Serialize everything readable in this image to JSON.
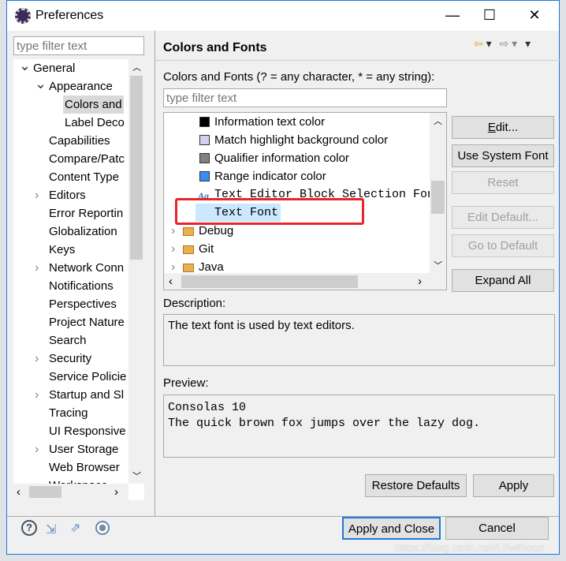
{
  "window": {
    "title": "Preferences",
    "minimize": "—",
    "maximize": "☐",
    "close": "✕"
  },
  "left": {
    "filter_placeholder": "type filter text",
    "tree": [
      {
        "label": "General",
        "level": 0,
        "expanded": true
      },
      {
        "label": "Appearance",
        "level": 1,
        "expanded": true
      },
      {
        "label": "Colors and",
        "level": 2,
        "selected": true
      },
      {
        "label": "Label Deco",
        "level": 2
      },
      {
        "label": "Capabilities",
        "level": 1
      },
      {
        "label": "Compare/Patc",
        "level": 1
      },
      {
        "label": "Content Type",
        "level": 1
      },
      {
        "label": "Editors",
        "level": 1,
        "expandable": true
      },
      {
        "label": "Error Reportin",
        "level": 1
      },
      {
        "label": "Globalization",
        "level": 1
      },
      {
        "label": "Keys",
        "level": 1
      },
      {
        "label": "Network Conn",
        "level": 1,
        "expandable": true
      },
      {
        "label": "Notifications",
        "level": 1
      },
      {
        "label": "Perspectives",
        "level": 1
      },
      {
        "label": "Project Nature",
        "level": 1
      },
      {
        "label": "Search",
        "level": 1
      },
      {
        "label": "Security",
        "level": 1,
        "expandable": true
      },
      {
        "label": "Service Policie",
        "level": 1
      },
      {
        "label": "Startup and Sl",
        "level": 1,
        "expandable": true
      },
      {
        "label": "Tracing",
        "level": 1
      },
      {
        "label": "UI Responsive",
        "level": 1
      },
      {
        "label": "User Storage",
        "level": 1,
        "expandable": true
      },
      {
        "label": "Web Browser",
        "level": 1
      },
      {
        "label": "Workspace",
        "level": 1,
        "expandable": true
      }
    ]
  },
  "main": {
    "title": "Colors and Fonts",
    "filter_label": "Colors and Fonts (? = any character, * = any string):",
    "filter_placeholder": "type filter text",
    "items": [
      {
        "label": "Information text color",
        "kind": "color",
        "color": "#000000"
      },
      {
        "label": "Match highlight background color",
        "kind": "color",
        "color": "#d4d0f0"
      },
      {
        "label": "Qualifier information color",
        "kind": "color",
        "color": "#808080"
      },
      {
        "label": "Range indicator color",
        "kind": "color",
        "color": "#3a8ef0"
      },
      {
        "label": "Text Editor Block Selection Font",
        "kind": "font"
      },
      {
        "label": "Text Font",
        "kind": "font",
        "selected": true
      },
      {
        "label": "Debug",
        "kind": "category"
      },
      {
        "label": "Git",
        "kind": "category"
      },
      {
        "label": "Java",
        "kind": "category"
      }
    ],
    "buttons": {
      "edit": "Edit...",
      "use_system_font": "Use System Font",
      "reset": "Reset",
      "edit_default": "Edit Default...",
      "go_to_default": "Go to Default",
      "expand_all": "Expand All"
    },
    "description_label": "Description:",
    "description": "The text font is used by text editors.",
    "preview_label": "Preview:",
    "preview_lines": [
      "Consolas 10",
      "The quick brown fox jumps over the lazy dog."
    ],
    "restore_defaults": "Restore Defaults",
    "apply": "Apply"
  },
  "footer": {
    "apply_and_close": "Apply and Close",
    "cancel": "Cancel",
    "watermark": "https://blog.csdn.net/Lifwthotpt"
  },
  "colors": {
    "accent": "#1e78d7",
    "highlight_box": "#e8262a",
    "selection": "#cce8ff"
  }
}
